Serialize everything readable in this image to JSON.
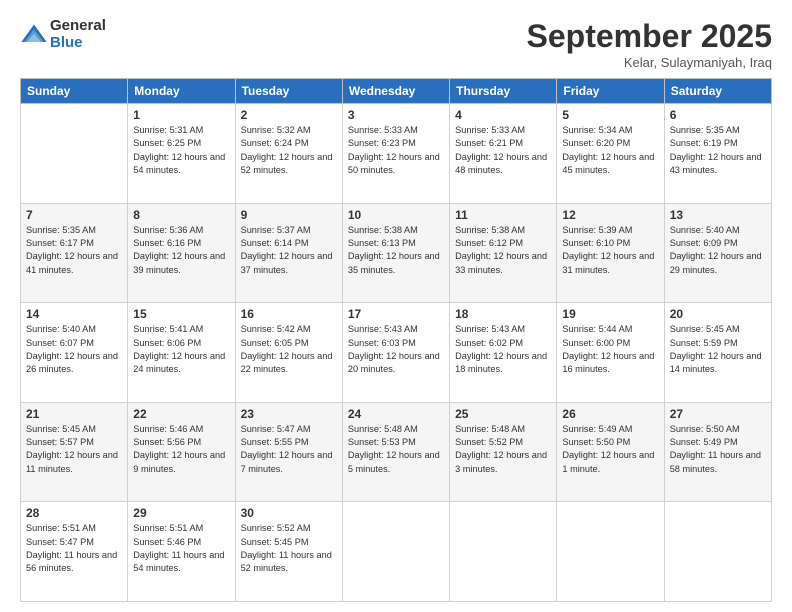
{
  "logo": {
    "general": "General",
    "blue": "Blue"
  },
  "title": "September 2025",
  "subtitle": "Kelar, Sulaymaniyah, Iraq",
  "columns": [
    "Sunday",
    "Monday",
    "Tuesday",
    "Wednesday",
    "Thursday",
    "Friday",
    "Saturday"
  ],
  "weeks": [
    [
      {
        "day": "",
        "info": ""
      },
      {
        "day": "1",
        "info": "Sunrise: 5:31 AM\nSunset: 6:25 PM\nDaylight: 12 hours\nand 54 minutes."
      },
      {
        "day": "2",
        "info": "Sunrise: 5:32 AM\nSunset: 6:24 PM\nDaylight: 12 hours\nand 52 minutes."
      },
      {
        "day": "3",
        "info": "Sunrise: 5:33 AM\nSunset: 6:23 PM\nDaylight: 12 hours\nand 50 minutes."
      },
      {
        "day": "4",
        "info": "Sunrise: 5:33 AM\nSunset: 6:21 PM\nDaylight: 12 hours\nand 48 minutes."
      },
      {
        "day": "5",
        "info": "Sunrise: 5:34 AM\nSunset: 6:20 PM\nDaylight: 12 hours\nand 45 minutes."
      },
      {
        "day": "6",
        "info": "Sunrise: 5:35 AM\nSunset: 6:19 PM\nDaylight: 12 hours\nand 43 minutes."
      }
    ],
    [
      {
        "day": "7",
        "info": "Sunrise: 5:35 AM\nSunset: 6:17 PM\nDaylight: 12 hours\nand 41 minutes."
      },
      {
        "day": "8",
        "info": "Sunrise: 5:36 AM\nSunset: 6:16 PM\nDaylight: 12 hours\nand 39 minutes."
      },
      {
        "day": "9",
        "info": "Sunrise: 5:37 AM\nSunset: 6:14 PM\nDaylight: 12 hours\nand 37 minutes."
      },
      {
        "day": "10",
        "info": "Sunrise: 5:38 AM\nSunset: 6:13 PM\nDaylight: 12 hours\nand 35 minutes."
      },
      {
        "day": "11",
        "info": "Sunrise: 5:38 AM\nSunset: 6:12 PM\nDaylight: 12 hours\nand 33 minutes."
      },
      {
        "day": "12",
        "info": "Sunrise: 5:39 AM\nSunset: 6:10 PM\nDaylight: 12 hours\nand 31 minutes."
      },
      {
        "day": "13",
        "info": "Sunrise: 5:40 AM\nSunset: 6:09 PM\nDaylight: 12 hours\nand 29 minutes."
      }
    ],
    [
      {
        "day": "14",
        "info": "Sunrise: 5:40 AM\nSunset: 6:07 PM\nDaylight: 12 hours\nand 26 minutes."
      },
      {
        "day": "15",
        "info": "Sunrise: 5:41 AM\nSunset: 6:06 PM\nDaylight: 12 hours\nand 24 minutes."
      },
      {
        "day": "16",
        "info": "Sunrise: 5:42 AM\nSunset: 6:05 PM\nDaylight: 12 hours\nand 22 minutes."
      },
      {
        "day": "17",
        "info": "Sunrise: 5:43 AM\nSunset: 6:03 PM\nDaylight: 12 hours\nand 20 minutes."
      },
      {
        "day": "18",
        "info": "Sunrise: 5:43 AM\nSunset: 6:02 PM\nDaylight: 12 hours\nand 18 minutes."
      },
      {
        "day": "19",
        "info": "Sunrise: 5:44 AM\nSunset: 6:00 PM\nDaylight: 12 hours\nand 16 minutes."
      },
      {
        "day": "20",
        "info": "Sunrise: 5:45 AM\nSunset: 5:59 PM\nDaylight: 12 hours\nand 14 minutes."
      }
    ],
    [
      {
        "day": "21",
        "info": "Sunrise: 5:45 AM\nSunset: 5:57 PM\nDaylight: 12 hours\nand 11 minutes."
      },
      {
        "day": "22",
        "info": "Sunrise: 5:46 AM\nSunset: 5:56 PM\nDaylight: 12 hours\nand 9 minutes."
      },
      {
        "day": "23",
        "info": "Sunrise: 5:47 AM\nSunset: 5:55 PM\nDaylight: 12 hours\nand 7 minutes."
      },
      {
        "day": "24",
        "info": "Sunrise: 5:48 AM\nSunset: 5:53 PM\nDaylight: 12 hours\nand 5 minutes."
      },
      {
        "day": "25",
        "info": "Sunrise: 5:48 AM\nSunset: 5:52 PM\nDaylight: 12 hours\nand 3 minutes."
      },
      {
        "day": "26",
        "info": "Sunrise: 5:49 AM\nSunset: 5:50 PM\nDaylight: 12 hours\nand 1 minute."
      },
      {
        "day": "27",
        "info": "Sunrise: 5:50 AM\nSunset: 5:49 PM\nDaylight: 11 hours\nand 58 minutes."
      }
    ],
    [
      {
        "day": "28",
        "info": "Sunrise: 5:51 AM\nSunset: 5:47 PM\nDaylight: 11 hours\nand 56 minutes."
      },
      {
        "day": "29",
        "info": "Sunrise: 5:51 AM\nSunset: 5:46 PM\nDaylight: 11 hours\nand 54 minutes."
      },
      {
        "day": "30",
        "info": "Sunrise: 5:52 AM\nSunset: 5:45 PM\nDaylight: 11 hours\nand 52 minutes."
      },
      {
        "day": "",
        "info": ""
      },
      {
        "day": "",
        "info": ""
      },
      {
        "day": "",
        "info": ""
      },
      {
        "day": "",
        "info": ""
      }
    ]
  ]
}
